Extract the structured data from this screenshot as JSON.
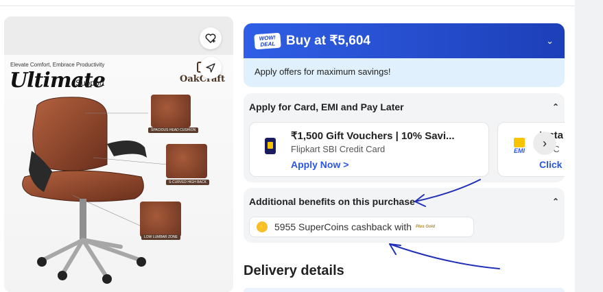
{
  "image": {
    "tagline": "Elevate Comfort, Embrace Productivity",
    "title_script": "Ultimate",
    "title_support": "Support",
    "brand": "OakCraft",
    "callouts": [
      "SPACIOUS HEAD CUSHION",
      "S-CURVED HIGH BACK",
      "LOW LUMBAR ZONE"
    ],
    "icons": [
      "wishlist-heart-icon",
      "share-icon"
    ]
  },
  "deal": {
    "badge_line1": "WOW!",
    "badge_line2": "DEAL",
    "buy_label": "Buy at ₹5,604",
    "subtitle": "Apply offers for maximum savings!",
    "accent": "#2a55e5"
  },
  "card_offers": {
    "heading": "Apply for Card, EMI and Pay Later",
    "items": [
      {
        "title": "₹1,500 Gift Vouchers | 10% Savi...",
        "desc": "Flipkart SBI Credit Card",
        "cta": "Apply Now >"
      },
      {
        "title": "Insta",
        "desc": "No C",
        "cta": "Click",
        "icon_label": "EMI"
      }
    ]
  },
  "benefits": {
    "heading": "Additional benefits on this purchase",
    "coins_text": "5955 SuperCoins cashback with",
    "plus_label": "Plus Gold"
  },
  "delivery": {
    "heading": "Delivery details"
  }
}
